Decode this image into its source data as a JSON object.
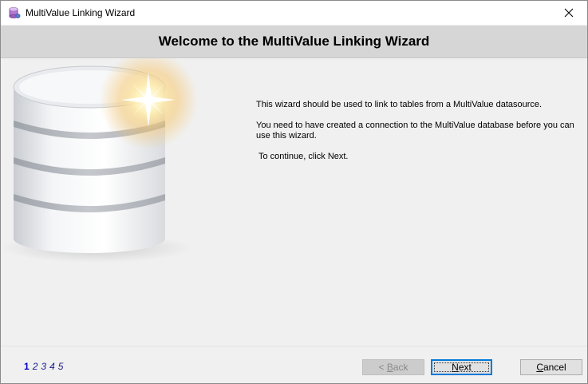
{
  "window": {
    "title": "MultiValue Linking Wizard"
  },
  "header": {
    "title": "Welcome to the MultiValue Linking Wizard"
  },
  "body": {
    "line1": "This wizard should be used to link to tables from a MultiValue datasource.",
    "line2": "You need to have created a connection to the MultiValue database before you can use this wizard.",
    "line3": "To continue, click Next."
  },
  "steps": {
    "items": [
      "1",
      "2",
      "3",
      "4",
      "5"
    ],
    "current": 1
  },
  "buttons": {
    "back_prefix": "< ",
    "back_access": "B",
    "back_rest": "ack",
    "next_access": "N",
    "next_rest": "ext",
    "cancel_access": "C",
    "cancel_rest": "ancel"
  },
  "colors": {
    "accent": "#0078d7",
    "header_band": "#d6d6d6",
    "step_link": "#1a1a8c"
  },
  "icons": {
    "app": "database-wizard-icon",
    "close": "close-icon",
    "art": "database-sparkle-illustration"
  }
}
